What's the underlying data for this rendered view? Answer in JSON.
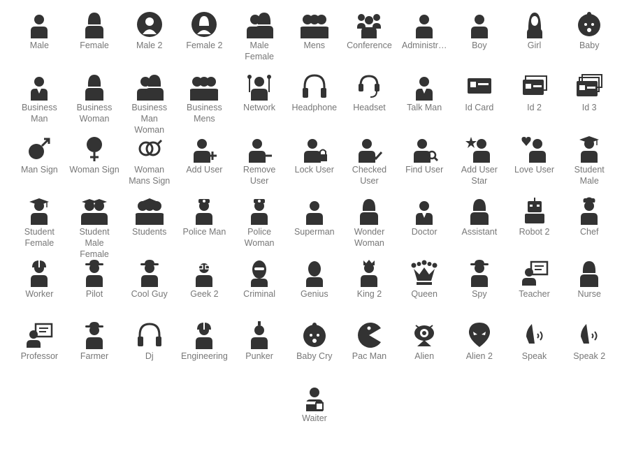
{
  "palette": {
    "icon": "#333333",
    "label": "#777777",
    "background": "#ffffff"
  },
  "rows": [
    [
      {
        "label": "Male",
        "icon": "male-icon",
        "type": "person"
      },
      {
        "label": "Female",
        "icon": "female-icon",
        "type": "woman"
      },
      {
        "label": "Male 2",
        "icon": "male-2-icon",
        "type": "circle-person"
      },
      {
        "label": "Female 2",
        "icon": "female-2-icon",
        "type": "circle-woman"
      },
      {
        "label": "Male\nFemale",
        "icon": "male-female-icon",
        "type": "pair"
      },
      {
        "label": "Mens",
        "icon": "mens-icon",
        "type": "group"
      },
      {
        "label": "Conference",
        "icon": "conference-icon",
        "type": "conference"
      },
      {
        "label": "Administr…",
        "icon": "administrator-icon",
        "type": "person"
      },
      {
        "label": "Boy",
        "icon": "boy-icon",
        "type": "person"
      },
      {
        "label": "Girl",
        "icon": "girl-icon",
        "type": "girl"
      },
      {
        "label": "Baby",
        "icon": "baby-icon",
        "type": "baby"
      }
    ],
    [
      {
        "label": "Business\nMan",
        "icon": "business-man-icon",
        "type": "suit"
      },
      {
        "label": "Business\nWoman",
        "icon": "business-woman-icon",
        "type": "woman"
      },
      {
        "label": "Business\nMan\nWoman",
        "icon": "business-man-woman-icon",
        "type": "pair"
      },
      {
        "label": "Business\nMens",
        "icon": "business-mens-icon",
        "type": "group"
      },
      {
        "label": "Network",
        "icon": "network-icon",
        "type": "network"
      },
      {
        "label": "Headphone",
        "icon": "headphone-icon",
        "type": "headphone"
      },
      {
        "label": "Headset",
        "icon": "headset-icon",
        "type": "headset"
      },
      {
        "label": "Talk Man",
        "icon": "talk-man-icon",
        "type": "suit"
      },
      {
        "label": "Id Card",
        "icon": "id-card-icon",
        "type": "card"
      },
      {
        "label": "Id 2",
        "icon": "id-2-icon",
        "type": "card2"
      },
      {
        "label": "Id 3",
        "icon": "id-3-icon",
        "type": "card3"
      }
    ],
    [
      {
        "label": "Man Sign",
        "icon": "man-sign-icon",
        "type": "mars"
      },
      {
        "label": "Woman Sign",
        "icon": "woman-sign-icon",
        "type": "venus"
      },
      {
        "label": "Woman\nMans Sign",
        "icon": "woman-mans-sign-icon",
        "type": "venusmars"
      },
      {
        "label": "Add User",
        "icon": "add-user-icon",
        "type": "person-plus"
      },
      {
        "label": "Remove\nUser",
        "icon": "remove-user-icon",
        "type": "person-minus"
      },
      {
        "label": "Lock User",
        "icon": "lock-user-icon",
        "type": "person-lock"
      },
      {
        "label": "Checked\nUser",
        "icon": "checked-user-icon",
        "type": "person-check"
      },
      {
        "label": "Find User",
        "icon": "find-user-icon",
        "type": "person-find"
      },
      {
        "label": "Add User\nStar",
        "icon": "add-user-star-icon",
        "type": "person-star"
      },
      {
        "label": "Love User",
        "icon": "love-user-icon",
        "type": "person-heart"
      },
      {
        "label": "Student\nMale",
        "icon": "student-male-icon",
        "type": "grad"
      }
    ],
    [
      {
        "label": "Student\nFemale",
        "icon": "student-female-icon",
        "type": "grad"
      },
      {
        "label": "Student\nMale\nFemale",
        "icon": "student-male-female-icon",
        "type": "grad-pair"
      },
      {
        "label": "Students",
        "icon": "students-icon",
        "type": "grad-group"
      },
      {
        "label": "Police Man",
        "icon": "police-man-icon",
        "type": "police"
      },
      {
        "label": "Police\nWoman",
        "icon": "police-woman-icon",
        "type": "police"
      },
      {
        "label": "Superman",
        "icon": "superman-icon",
        "type": "person"
      },
      {
        "label": "Wonder\nWoman",
        "icon": "wonder-woman-icon",
        "type": "woman"
      },
      {
        "label": "Doctor",
        "icon": "doctor-icon",
        "type": "suit"
      },
      {
        "label": "Assistant",
        "icon": "assistant-icon",
        "type": "woman"
      },
      {
        "label": "Robot 2",
        "icon": "robot-2-icon",
        "type": "robot"
      },
      {
        "label": "Chef",
        "icon": "chef-icon",
        "type": "chef"
      }
    ],
    [
      {
        "label": "Worker",
        "icon": "worker-icon",
        "type": "helmet"
      },
      {
        "label": "Pilot",
        "icon": "pilot-icon",
        "type": "hat"
      },
      {
        "label": "Cool Guy",
        "icon": "cool-guy-icon",
        "type": "hat"
      },
      {
        "label": "Geek 2",
        "icon": "geek-2-icon",
        "type": "geek"
      },
      {
        "label": "Criminal",
        "icon": "criminal-icon",
        "type": "mask"
      },
      {
        "label": "Genius",
        "icon": "genius-icon",
        "type": "bald"
      },
      {
        "label": "King 2",
        "icon": "king-2-icon",
        "type": "king"
      },
      {
        "label": "Queen",
        "icon": "queen-icon",
        "type": "crown"
      },
      {
        "label": "Spy",
        "icon": "spy-icon",
        "type": "hat"
      },
      {
        "label": "Teacher",
        "icon": "teacher-icon",
        "type": "board"
      },
      {
        "label": "Nurse",
        "icon": "nurse-icon",
        "type": "woman"
      }
    ],
    [
      {
        "label": "Professor",
        "icon": "professor-icon",
        "type": "board"
      },
      {
        "label": "Farmer",
        "icon": "farmer-icon",
        "type": "hat"
      },
      {
        "label": "Dj",
        "icon": "dj-icon",
        "type": "headphone"
      },
      {
        "label": "Engineering",
        "icon": "engineering-icon",
        "type": "helmet"
      },
      {
        "label": "Punker",
        "icon": "punker-icon",
        "type": "punk"
      },
      {
        "label": "Baby Cry",
        "icon": "baby-cry-icon",
        "type": "baby"
      },
      {
        "label": "Pac Man",
        "icon": "pac-man-icon",
        "type": "pac"
      },
      {
        "label": "Alien",
        "icon": "alien-icon",
        "type": "alien"
      },
      {
        "label": "Alien 2",
        "icon": "alien-2-icon",
        "type": "alien2"
      },
      {
        "label": "Speak",
        "icon": "speak-icon",
        "type": "speak"
      },
      {
        "label": "Speak 2",
        "icon": "speak-2-icon",
        "type": "speak"
      }
    ],
    [
      {
        "label": "Waiter",
        "icon": "waiter-icon",
        "type": "waiter"
      }
    ]
  ]
}
